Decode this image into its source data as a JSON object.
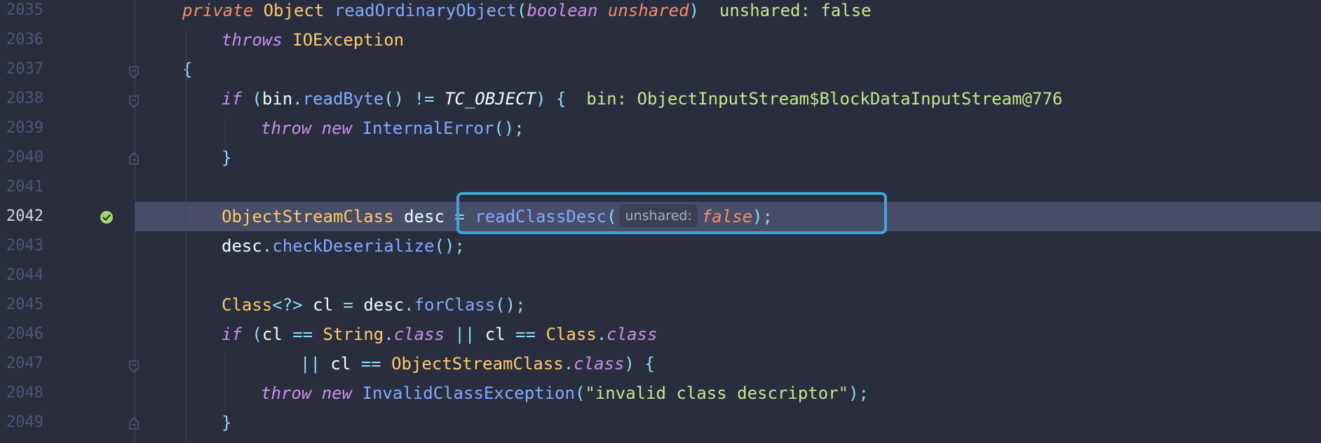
{
  "editor": {
    "lines": [
      {
        "number": "2035",
        "tokens": [
          {
            "t": "private",
            "c": "kw2"
          },
          {
            "t": " "
          },
          {
            "t": "Object",
            "c": "type"
          },
          {
            "t": " "
          },
          {
            "t": "readOrdinaryObject",
            "c": "fn"
          },
          {
            "t": "(",
            "c": "punc"
          },
          {
            "t": "boolean",
            "c": "kw"
          },
          {
            "t": " "
          },
          {
            "t": "unshared",
            "c": "kw2n"
          },
          {
            "t": ")",
            "c": "punc"
          },
          {
            "t": "  "
          },
          {
            "t": "unshared: false",
            "c": "inline-val"
          }
        ]
      },
      {
        "number": "2036",
        "tokens": [
          {
            "t": "throws",
            "c": "kw"
          },
          {
            "t": " "
          },
          {
            "t": "IOException",
            "c": "type"
          }
        ]
      },
      {
        "number": "2037",
        "tokens": [
          {
            "t": "{",
            "c": "punc"
          }
        ]
      },
      {
        "number": "2038",
        "tokens": [
          {
            "t": "if",
            "c": "kw"
          },
          {
            "t": " "
          },
          {
            "t": "(",
            "c": "punc"
          },
          {
            "t": "bin"
          },
          {
            "t": ".",
            "c": "punc"
          },
          {
            "t": "readByte",
            "c": "fn"
          },
          {
            "t": "()",
            "c": "punc"
          },
          {
            "t": " "
          },
          {
            "t": "!=",
            "c": "punc"
          },
          {
            "t": " "
          },
          {
            "t": "TC_OBJECT",
            "c": "const"
          },
          {
            "t": ")",
            "c": "punc"
          },
          {
            "t": " "
          },
          {
            "t": "{",
            "c": "punc"
          },
          {
            "t": "  "
          },
          {
            "t": "bin: ObjectInputStream$BlockDataInputStream@776",
            "c": "inline-val"
          }
        ]
      },
      {
        "number": "2039",
        "tokens": [
          {
            "t": "throw",
            "c": "kw"
          },
          {
            "t": " "
          },
          {
            "t": "new",
            "c": "kw"
          },
          {
            "t": " "
          },
          {
            "t": "InternalError",
            "c": "fn"
          },
          {
            "t": "();",
            "c": "punc"
          }
        ]
      },
      {
        "number": "2040",
        "tokens": [
          {
            "t": "}",
            "c": "punc"
          }
        ]
      },
      {
        "number": "2041",
        "tokens": []
      },
      {
        "number": "2042",
        "tokens": [
          {
            "t": "ObjectStreamClass",
            "c": "type"
          },
          {
            "t": " "
          },
          {
            "t": "desc"
          },
          {
            "t": " "
          },
          {
            "t": "=",
            "c": "punc"
          },
          {
            "t": " "
          },
          {
            "t": "readClassDesc",
            "c": "fn"
          },
          {
            "t": "(",
            "c": "punc"
          },
          {
            "hint": "unshared:"
          },
          {
            "t": "false",
            "c": "kw2"
          },
          {
            "t": ");",
            "c": "punc"
          }
        ]
      },
      {
        "number": "2043",
        "tokens": [
          {
            "t": "desc"
          },
          {
            "t": ".",
            "c": "punc"
          },
          {
            "t": "checkDeserialize",
            "c": "fn"
          },
          {
            "t": "();",
            "c": "punc"
          }
        ]
      },
      {
        "number": "2044",
        "tokens": []
      },
      {
        "number": "2045",
        "tokens": [
          {
            "t": "Class",
            "c": "type"
          },
          {
            "t": "<?>",
            "c": "punc"
          },
          {
            "t": " "
          },
          {
            "t": "cl"
          },
          {
            "t": " "
          },
          {
            "t": "=",
            "c": "punc"
          },
          {
            "t": " "
          },
          {
            "t": "desc"
          },
          {
            "t": ".",
            "c": "punc"
          },
          {
            "t": "forClass",
            "c": "fn"
          },
          {
            "t": "();",
            "c": "punc"
          }
        ]
      },
      {
        "number": "2046",
        "tokens": [
          {
            "t": "if",
            "c": "kw"
          },
          {
            "t": " "
          },
          {
            "t": "(",
            "c": "punc"
          },
          {
            "t": "cl"
          },
          {
            "t": " "
          },
          {
            "t": "==",
            "c": "punc"
          },
          {
            "t": " "
          },
          {
            "t": "String",
            "c": "type"
          },
          {
            "t": ".",
            "c": "punc"
          },
          {
            "t": "class",
            "c": "kw"
          },
          {
            "t": " "
          },
          {
            "t": "||",
            "c": "punc"
          },
          {
            "t": " "
          },
          {
            "t": "cl"
          },
          {
            "t": " "
          },
          {
            "t": "==",
            "c": "punc"
          },
          {
            "t": " "
          },
          {
            "t": "Class",
            "c": "type"
          },
          {
            "t": ".",
            "c": "punc"
          },
          {
            "t": "class",
            "c": "kw"
          }
        ]
      },
      {
        "number": "2047",
        "tokens": [
          {
            "t": "||",
            "c": "punc"
          },
          {
            "t": " "
          },
          {
            "t": "cl"
          },
          {
            "t": " "
          },
          {
            "t": "==",
            "c": "punc"
          },
          {
            "t": " "
          },
          {
            "t": "ObjectStreamClass",
            "c": "type"
          },
          {
            "t": ".",
            "c": "punc"
          },
          {
            "t": "class",
            "c": "kw"
          },
          {
            "t": ")",
            "c": "punc"
          },
          {
            "t": " "
          },
          {
            "t": "{",
            "c": "punc"
          }
        ]
      },
      {
        "number": "2048",
        "tokens": [
          {
            "t": "throw",
            "c": "kw"
          },
          {
            "t": " "
          },
          {
            "t": "new",
            "c": "kw"
          },
          {
            "t": " "
          },
          {
            "t": "InvalidClassException",
            "c": "fn"
          },
          {
            "t": "(",
            "c": "punc"
          },
          {
            "t": "\"invalid class descriptor\"",
            "c": "str"
          },
          {
            "t": ");",
            "c": "punc"
          }
        ]
      },
      {
        "number": "2049",
        "tokens": [
          {
            "t": "}",
            "c": "punc"
          }
        ]
      }
    ]
  }
}
